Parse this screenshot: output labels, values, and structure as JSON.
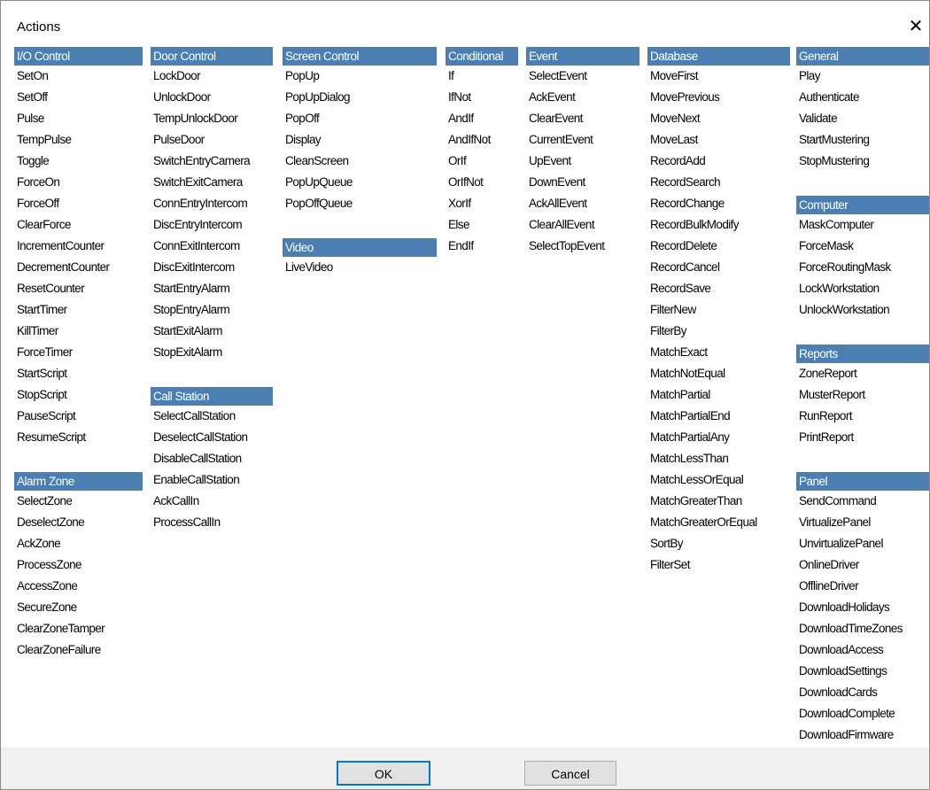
{
  "window": {
    "title": "Actions",
    "close_glyph": "✕"
  },
  "groups": {
    "io_control": {
      "header": "I/O Control",
      "items": [
        "SetOn",
        "SetOff",
        "Pulse",
        "TempPulse",
        "Toggle",
        "ForceOn",
        "ForceOff",
        "ClearForce",
        "IncrementCounter",
        "DecrementCounter",
        "ResetCounter",
        "StartTimer",
        "KillTimer",
        "ForceTimer",
        "StartScript",
        "StopScript",
        "PauseScript",
        "ResumeScript"
      ]
    },
    "alarm_zone": {
      "header": "Alarm Zone",
      "items": [
        "SelectZone",
        "DeselectZone",
        "AckZone",
        "ProcessZone",
        "AccessZone",
        "SecureZone",
        "ClearZoneTamper",
        "ClearZoneFailure"
      ]
    },
    "door_control": {
      "header": "Door Control",
      "items": [
        "LockDoor",
        "UnlockDoor",
        "TempUnlockDoor",
        "PulseDoor",
        "SwitchEntryCamera",
        "SwitchExitCamera",
        "ConnEntryIntercom",
        "DiscEntryIntercom",
        "ConnExitIntercom",
        "DiscExitIntercom",
        "StartEntryAlarm",
        "StopEntryAlarm",
        "StartExitAlarm",
        "StopExitAlarm"
      ]
    },
    "call_station": {
      "header": "Call Station",
      "items": [
        "SelectCallStation",
        "DeselectCallStation",
        "DisableCallStation",
        "EnableCallStation",
        "AckCallIn",
        "ProcessCallIn"
      ]
    },
    "screen_control": {
      "header": "Screen Control",
      "items": [
        "PopUp",
        "PopUpDialog",
        "PopOff",
        "Display",
        "CleanScreen",
        "PopUpQueue",
        "PopOffQueue"
      ]
    },
    "video": {
      "header": "Video",
      "items": [
        "LiveVideo"
      ]
    },
    "conditional": {
      "header": "Conditional",
      "items": [
        "If",
        "IfNot",
        "AndIf",
        "AndIfNot",
        "OrIf",
        "OrIfNot",
        "XorIf",
        "Else",
        "EndIf"
      ]
    },
    "event": {
      "header": "Event",
      "items": [
        "SelectEvent",
        "AckEvent",
        "ClearEvent",
        "CurrentEvent",
        "UpEvent",
        "DownEvent",
        "AckAllEvent",
        "ClearAllEvent",
        "SelectTopEvent"
      ]
    },
    "database": {
      "header": "Database",
      "items": [
        "MoveFirst",
        "MovePrevious",
        "MoveNext",
        "MoveLast",
        "RecordAdd",
        "RecordSearch",
        "RecordChange",
        "RecordBulkModify",
        "RecordDelete",
        "RecordCancel",
        "RecordSave",
        "FilterNew",
        "FilterBy",
        "MatchExact",
        "MatchNotEqual",
        "MatchPartial",
        "MatchPartialEnd",
        "MatchPartialAny",
        "MatchLessThan",
        "MatchLessOrEqual",
        "MatchGreaterThan",
        "MatchGreaterOrEqual",
        "SortBy",
        "FilterSet"
      ]
    },
    "general": {
      "header": "General",
      "items": [
        "Play",
        "Authenticate",
        "Validate",
        "StartMustering",
        "StopMustering"
      ]
    },
    "computer": {
      "header": "Computer",
      "items": [
        "MaskComputer",
        "ForceMask",
        "ForceRoutingMask",
        "LockWorkstation",
        "UnlockWorkstation"
      ]
    },
    "reports": {
      "header": "Reports",
      "items": [
        "ZoneReport",
        "MusterReport",
        "RunReport",
        "PrintReport"
      ]
    },
    "panel": {
      "header": "Panel",
      "items": [
        "SendCommand",
        "VirtualizePanel",
        "UnvirtualizePanel",
        "OnlineDriver",
        "OfflineDriver",
        "DownloadHolidays",
        "DownloadTimeZones",
        "DownloadAccess",
        "DownloadSettings",
        "DownloadCards",
        "DownloadComplete",
        "DownloadFirmware"
      ]
    }
  },
  "footer": {
    "ok_label": "OK",
    "cancel_label": "Cancel"
  },
  "colors": {
    "header_bg": "#4b7eb3",
    "header_fg": "#ffffff",
    "footer_bg": "#f0f0f0",
    "default_button_border": "#0078d7"
  }
}
